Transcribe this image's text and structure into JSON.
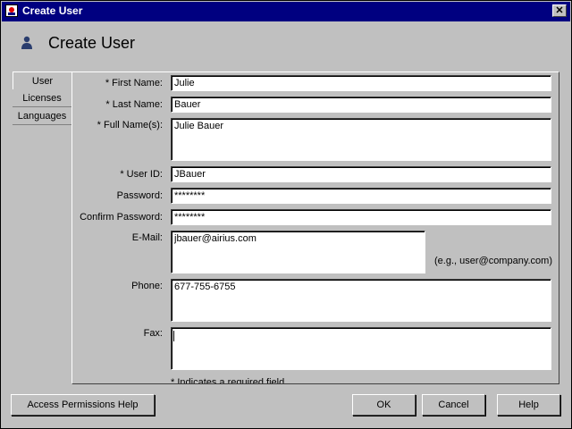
{
  "window": {
    "title": "Create User",
    "close_label": "✕"
  },
  "header": {
    "title": "Create User",
    "icon": "user-icon"
  },
  "tabs": [
    {
      "label": "User",
      "active": true
    },
    {
      "label": "Licenses",
      "active": false
    },
    {
      "label": "Languages",
      "active": false
    }
  ],
  "form": {
    "first_name": {
      "label": "* First Name:",
      "value": "Julie"
    },
    "last_name": {
      "label": "* Last Name:",
      "value": "Bauer"
    },
    "full_name": {
      "label": "* Full Name(s):",
      "value": "Julie Bauer"
    },
    "user_id": {
      "label": "* User ID:",
      "value": "JBauer"
    },
    "password": {
      "label": "Password:",
      "value": "********"
    },
    "confirm_password": {
      "label": "Confirm Password:",
      "value": "********"
    },
    "email": {
      "label": "E-Mail:",
      "value": "jbauer@airius.com",
      "hint": "(e.g., user@company.com)"
    },
    "phone": {
      "label": "Phone:",
      "value": "677-755-6755"
    },
    "fax": {
      "label": "Fax:",
      "value": ""
    },
    "required_note": "* Indicates a required field"
  },
  "buttons": {
    "access_help": "Access Permissions Help",
    "ok": "OK",
    "cancel": "Cancel",
    "help": "Help"
  }
}
